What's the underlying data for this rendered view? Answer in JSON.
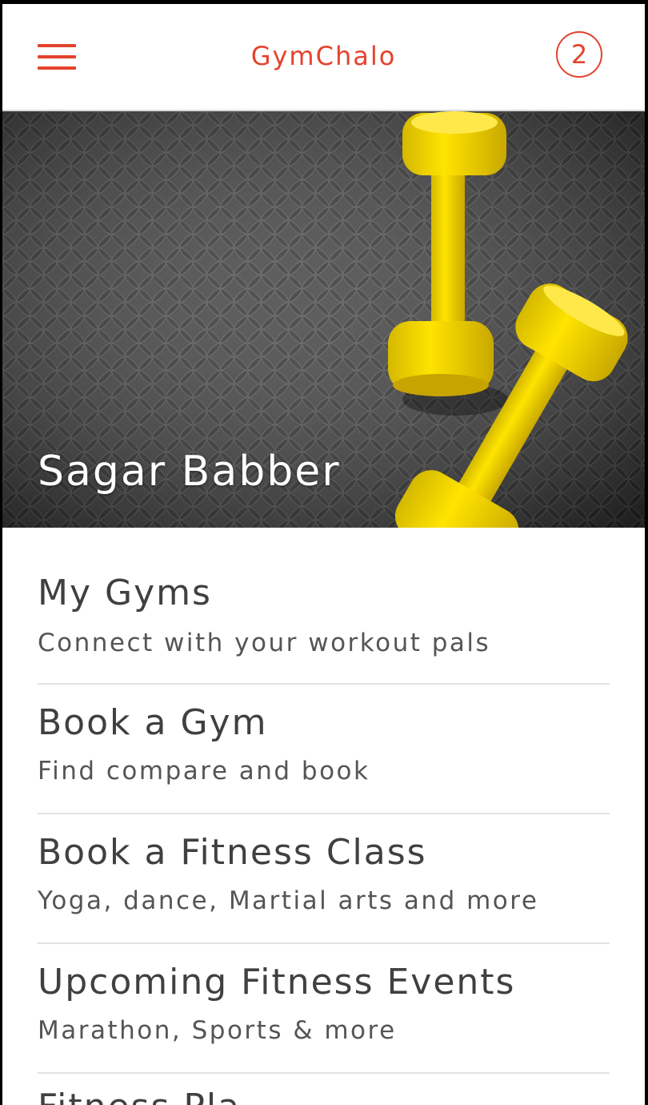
{
  "header": {
    "app_title": "GymChalo",
    "notification_count": "2",
    "menu_icon": "hamburger-menu-icon"
  },
  "hero": {
    "user_name": "Sagar Babber",
    "image": "yellow-dumbbells-on-rubber-mat"
  },
  "menu": {
    "items": [
      {
        "title": "My Gyms",
        "subtitle": "Connect with your workout pals"
      },
      {
        "title": "Book a Gym",
        "subtitle": "Find compare and book"
      },
      {
        "title": "Book a Fitness Class",
        "subtitle": "Yoga, dance, Martial arts and more"
      },
      {
        "title": "Upcoming Fitness Events",
        "subtitle": "Marathon, Sports & more"
      },
      {
        "title": "Fitness Pla"
      }
    ]
  },
  "colors": {
    "accent": "#e4432d",
    "text_dark": "#404040",
    "text_sub": "#555555",
    "divider": "#e2e2e2"
  }
}
